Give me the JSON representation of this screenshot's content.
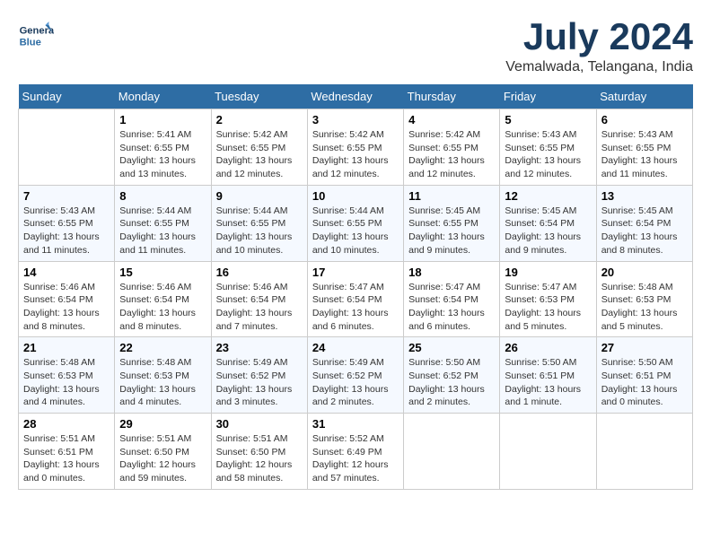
{
  "header": {
    "logo_line1": "General",
    "logo_line2": "Blue",
    "month": "July 2024",
    "location": "Vemalwada, Telangana, India"
  },
  "weekdays": [
    "Sunday",
    "Monday",
    "Tuesday",
    "Wednesday",
    "Thursday",
    "Friday",
    "Saturday"
  ],
  "weeks": [
    [
      {
        "day": "",
        "sunrise": "",
        "sunset": "",
        "daylight": ""
      },
      {
        "day": "1",
        "sunrise": "Sunrise: 5:41 AM",
        "sunset": "Sunset: 6:55 PM",
        "daylight": "Daylight: 13 hours and 13 minutes."
      },
      {
        "day": "2",
        "sunrise": "Sunrise: 5:42 AM",
        "sunset": "Sunset: 6:55 PM",
        "daylight": "Daylight: 13 hours and 12 minutes."
      },
      {
        "day": "3",
        "sunrise": "Sunrise: 5:42 AM",
        "sunset": "Sunset: 6:55 PM",
        "daylight": "Daylight: 13 hours and 12 minutes."
      },
      {
        "day": "4",
        "sunrise": "Sunrise: 5:42 AM",
        "sunset": "Sunset: 6:55 PM",
        "daylight": "Daylight: 13 hours and 12 minutes."
      },
      {
        "day": "5",
        "sunrise": "Sunrise: 5:43 AM",
        "sunset": "Sunset: 6:55 PM",
        "daylight": "Daylight: 13 hours and 12 minutes."
      },
      {
        "day": "6",
        "sunrise": "Sunrise: 5:43 AM",
        "sunset": "Sunset: 6:55 PM",
        "daylight": "Daylight: 13 hours and 11 minutes."
      }
    ],
    [
      {
        "day": "7",
        "sunrise": "Sunrise: 5:43 AM",
        "sunset": "Sunset: 6:55 PM",
        "daylight": "Daylight: 13 hours and 11 minutes."
      },
      {
        "day": "8",
        "sunrise": "Sunrise: 5:44 AM",
        "sunset": "Sunset: 6:55 PM",
        "daylight": "Daylight: 13 hours and 11 minutes."
      },
      {
        "day": "9",
        "sunrise": "Sunrise: 5:44 AM",
        "sunset": "Sunset: 6:55 PM",
        "daylight": "Daylight: 13 hours and 10 minutes."
      },
      {
        "day": "10",
        "sunrise": "Sunrise: 5:44 AM",
        "sunset": "Sunset: 6:55 PM",
        "daylight": "Daylight: 13 hours and 10 minutes."
      },
      {
        "day": "11",
        "sunrise": "Sunrise: 5:45 AM",
        "sunset": "Sunset: 6:55 PM",
        "daylight": "Daylight: 13 hours and 9 minutes."
      },
      {
        "day": "12",
        "sunrise": "Sunrise: 5:45 AM",
        "sunset": "Sunset: 6:54 PM",
        "daylight": "Daylight: 13 hours and 9 minutes."
      },
      {
        "day": "13",
        "sunrise": "Sunrise: 5:45 AM",
        "sunset": "Sunset: 6:54 PM",
        "daylight": "Daylight: 13 hours and 8 minutes."
      }
    ],
    [
      {
        "day": "14",
        "sunrise": "Sunrise: 5:46 AM",
        "sunset": "Sunset: 6:54 PM",
        "daylight": "Daylight: 13 hours and 8 minutes."
      },
      {
        "day": "15",
        "sunrise": "Sunrise: 5:46 AM",
        "sunset": "Sunset: 6:54 PM",
        "daylight": "Daylight: 13 hours and 8 minutes."
      },
      {
        "day": "16",
        "sunrise": "Sunrise: 5:46 AM",
        "sunset": "Sunset: 6:54 PM",
        "daylight": "Daylight: 13 hours and 7 minutes."
      },
      {
        "day": "17",
        "sunrise": "Sunrise: 5:47 AM",
        "sunset": "Sunset: 6:54 PM",
        "daylight": "Daylight: 13 hours and 6 minutes."
      },
      {
        "day": "18",
        "sunrise": "Sunrise: 5:47 AM",
        "sunset": "Sunset: 6:54 PM",
        "daylight": "Daylight: 13 hours and 6 minutes."
      },
      {
        "day": "19",
        "sunrise": "Sunrise: 5:47 AM",
        "sunset": "Sunset: 6:53 PM",
        "daylight": "Daylight: 13 hours and 5 minutes."
      },
      {
        "day": "20",
        "sunrise": "Sunrise: 5:48 AM",
        "sunset": "Sunset: 6:53 PM",
        "daylight": "Daylight: 13 hours and 5 minutes."
      }
    ],
    [
      {
        "day": "21",
        "sunrise": "Sunrise: 5:48 AM",
        "sunset": "Sunset: 6:53 PM",
        "daylight": "Daylight: 13 hours and 4 minutes."
      },
      {
        "day": "22",
        "sunrise": "Sunrise: 5:48 AM",
        "sunset": "Sunset: 6:53 PM",
        "daylight": "Daylight: 13 hours and 4 minutes."
      },
      {
        "day": "23",
        "sunrise": "Sunrise: 5:49 AM",
        "sunset": "Sunset: 6:52 PM",
        "daylight": "Daylight: 13 hours and 3 minutes."
      },
      {
        "day": "24",
        "sunrise": "Sunrise: 5:49 AM",
        "sunset": "Sunset: 6:52 PM",
        "daylight": "Daylight: 13 hours and 2 minutes."
      },
      {
        "day": "25",
        "sunrise": "Sunrise: 5:50 AM",
        "sunset": "Sunset: 6:52 PM",
        "daylight": "Daylight: 13 hours and 2 minutes."
      },
      {
        "day": "26",
        "sunrise": "Sunrise: 5:50 AM",
        "sunset": "Sunset: 6:51 PM",
        "daylight": "Daylight: 13 hours and 1 minute."
      },
      {
        "day": "27",
        "sunrise": "Sunrise: 5:50 AM",
        "sunset": "Sunset: 6:51 PM",
        "daylight": "Daylight: 13 hours and 0 minutes."
      }
    ],
    [
      {
        "day": "28",
        "sunrise": "Sunrise: 5:51 AM",
        "sunset": "Sunset: 6:51 PM",
        "daylight": "Daylight: 13 hours and 0 minutes."
      },
      {
        "day": "29",
        "sunrise": "Sunrise: 5:51 AM",
        "sunset": "Sunset: 6:50 PM",
        "daylight": "Daylight: 12 hours and 59 minutes."
      },
      {
        "day": "30",
        "sunrise": "Sunrise: 5:51 AM",
        "sunset": "Sunset: 6:50 PM",
        "daylight": "Daylight: 12 hours and 58 minutes."
      },
      {
        "day": "31",
        "sunrise": "Sunrise: 5:52 AM",
        "sunset": "Sunset: 6:49 PM",
        "daylight": "Daylight: 12 hours and 57 minutes."
      },
      {
        "day": "",
        "sunrise": "",
        "sunset": "",
        "daylight": ""
      },
      {
        "day": "",
        "sunrise": "",
        "sunset": "",
        "daylight": ""
      },
      {
        "day": "",
        "sunrise": "",
        "sunset": "",
        "daylight": ""
      }
    ]
  ]
}
